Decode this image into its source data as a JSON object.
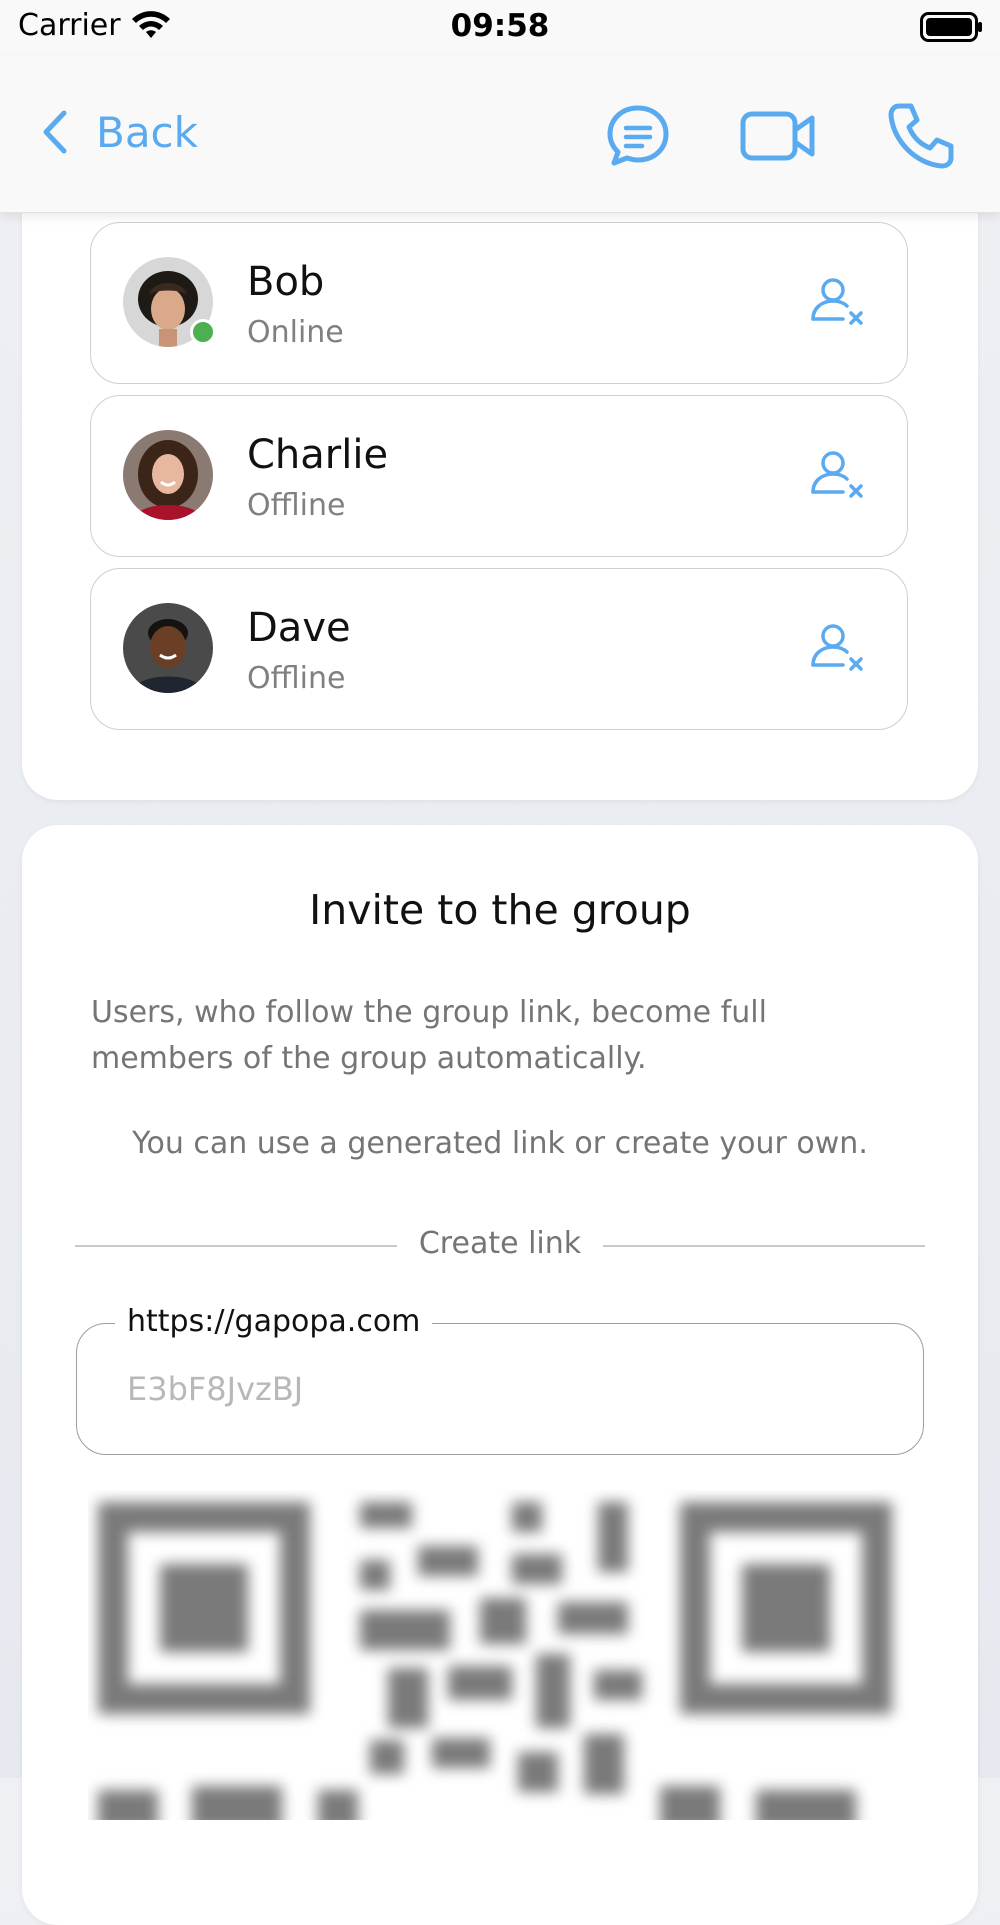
{
  "status_bar": {
    "carrier": "Carrier",
    "time": "09:58"
  },
  "nav": {
    "back_label": "Back",
    "icons": [
      "chat-bubble-icon",
      "video-camera-icon",
      "phone-icon"
    ],
    "accent_color": "#5aaaf0"
  },
  "members": [
    {
      "name": "Bob",
      "status": "Online",
      "online": true,
      "remove_icon": "remove-user-icon"
    },
    {
      "name": "Charlie",
      "status": "Offline",
      "online": false,
      "remove_icon": "remove-user-icon"
    },
    {
      "name": "Dave",
      "status": "Offline",
      "online": false,
      "remove_icon": "remove-user-icon"
    }
  ],
  "invite": {
    "title": "Invite to the group",
    "description": "Users, who follow the group link, become full members of the group automatically.",
    "hint": "You can use a generated link or create your own.",
    "divider_label": "Create link",
    "link_field": {
      "label": "https://gapopa.com",
      "value": "",
      "placeholder": "E3bF8JvzBJ"
    },
    "qr_icon": "qr-code-icon"
  },
  "colors": {
    "online": "#4caf50",
    "muted_text": "#757575",
    "background": "#e6e9ef"
  }
}
